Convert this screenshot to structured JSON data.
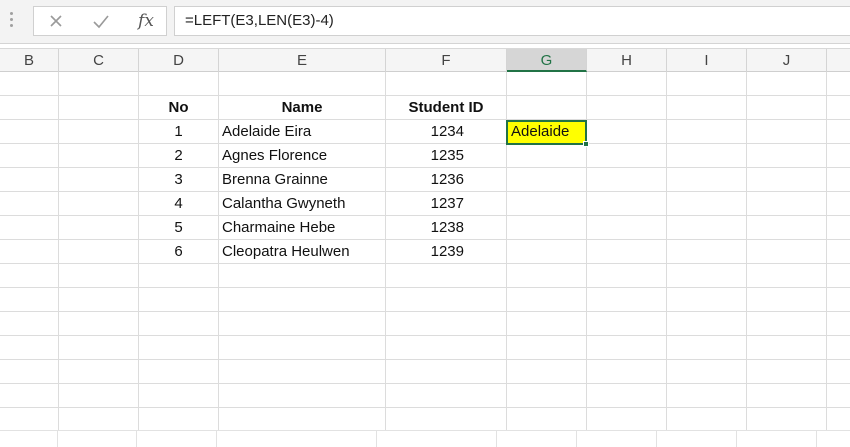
{
  "formula_bar": {
    "formula": "=LEFT(E3,LEN(E3)-4)",
    "cancel_icon": "x-icon",
    "enter_icon": "check-icon",
    "function_icon": "fx-icon",
    "fx_label": "fx"
  },
  "columns": [
    "B",
    "C",
    "D",
    "E",
    "F",
    "G",
    "H",
    "I",
    "J"
  ],
  "active_column": "G",
  "table": {
    "headers": {
      "no": "No",
      "name": "Name",
      "student_id": "Student ID"
    },
    "rows": [
      {
        "no": "1",
        "name": "Adelaide Eira",
        "student_id": "1234"
      },
      {
        "no": "2",
        "name": "Agnes Florence",
        "student_id": "1235"
      },
      {
        "no": "3",
        "name": "Brenna Grainne",
        "student_id": "1236"
      },
      {
        "no": "4",
        "name": "Calantha Gwyneth",
        "student_id": "1237"
      },
      {
        "no": "5",
        "name": "Charmaine Hebe",
        "student_id": "1238"
      },
      {
        "no": "6",
        "name": "Cleopatra Heulwen",
        "student_id": "1239"
      }
    ]
  },
  "selected_cell": {
    "value": "Adelaide",
    "fill_color": "#ffff00",
    "border_color": "#217346"
  }
}
